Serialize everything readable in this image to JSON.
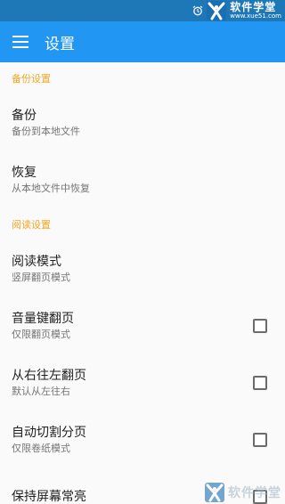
{
  "status_bar": {
    "watermark_name": "软件学堂",
    "watermark_url": "www.xue51.com"
  },
  "app_bar": {
    "title": "设置",
    "menu_icon": "menu-icon"
  },
  "sections": {
    "backup": {
      "header": "备份设置",
      "items": [
        {
          "title": "备份",
          "summary": "备份到本地文件"
        },
        {
          "title": "恢复",
          "summary": "从本地文件中恢复"
        }
      ]
    },
    "reading": {
      "header": "阅读设置",
      "items": [
        {
          "title": "阅读模式",
          "summary": "竖屏翻页模式"
        },
        {
          "title": "音量键翻页",
          "summary": "仅限翻页模式",
          "checked": false
        },
        {
          "title": "从右往左翻页",
          "summary": "默认从左往右",
          "checked": false
        },
        {
          "title": "自动切割分页",
          "summary": "仅限卷纸模式",
          "checked": false
        },
        {
          "title": "保持屏幕常亮",
          "summary": "",
          "checked": false
        }
      ]
    }
  },
  "bottom_watermark": "软件学堂",
  "colors": {
    "status_bar": "#1e78b8",
    "app_bar": "#2196f3",
    "section_header": "#f5a623",
    "title_text": "#212121",
    "summary_text": "#757575"
  }
}
